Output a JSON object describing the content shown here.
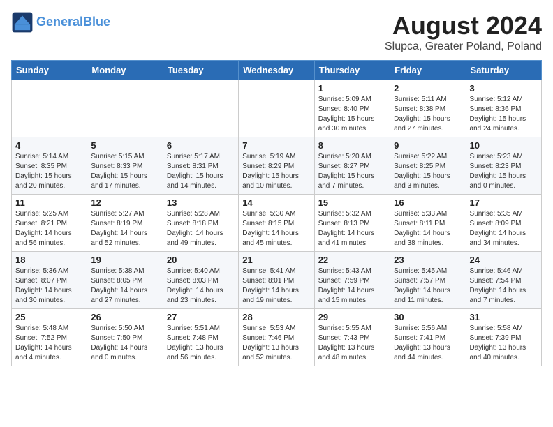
{
  "header": {
    "logo_line1": "General",
    "logo_line2": "Blue",
    "month_year": "August 2024",
    "location": "Slupca, Greater Poland, Poland"
  },
  "weekdays": [
    "Sunday",
    "Monday",
    "Tuesday",
    "Wednesday",
    "Thursday",
    "Friday",
    "Saturday"
  ],
  "weeks": [
    [
      {
        "day": "",
        "sunrise": "",
        "sunset": "",
        "daylight": ""
      },
      {
        "day": "",
        "sunrise": "",
        "sunset": "",
        "daylight": ""
      },
      {
        "day": "",
        "sunrise": "",
        "sunset": "",
        "daylight": ""
      },
      {
        "day": "",
        "sunrise": "",
        "sunset": "",
        "daylight": ""
      },
      {
        "day": "1",
        "sunrise": "Sunrise: 5:09 AM",
        "sunset": "Sunset: 8:40 PM",
        "daylight": "Daylight: 15 hours and 30 minutes."
      },
      {
        "day": "2",
        "sunrise": "Sunrise: 5:11 AM",
        "sunset": "Sunset: 8:38 PM",
        "daylight": "Daylight: 15 hours and 27 minutes."
      },
      {
        "day": "3",
        "sunrise": "Sunrise: 5:12 AM",
        "sunset": "Sunset: 8:36 PM",
        "daylight": "Daylight: 15 hours and 24 minutes."
      }
    ],
    [
      {
        "day": "4",
        "sunrise": "Sunrise: 5:14 AM",
        "sunset": "Sunset: 8:35 PM",
        "daylight": "Daylight: 15 hours and 20 minutes."
      },
      {
        "day": "5",
        "sunrise": "Sunrise: 5:15 AM",
        "sunset": "Sunset: 8:33 PM",
        "daylight": "Daylight: 15 hours and 17 minutes."
      },
      {
        "day": "6",
        "sunrise": "Sunrise: 5:17 AM",
        "sunset": "Sunset: 8:31 PM",
        "daylight": "Daylight: 15 hours and 14 minutes."
      },
      {
        "day": "7",
        "sunrise": "Sunrise: 5:19 AM",
        "sunset": "Sunset: 8:29 PM",
        "daylight": "Daylight: 15 hours and 10 minutes."
      },
      {
        "day": "8",
        "sunrise": "Sunrise: 5:20 AM",
        "sunset": "Sunset: 8:27 PM",
        "daylight": "Daylight: 15 hours and 7 minutes."
      },
      {
        "day": "9",
        "sunrise": "Sunrise: 5:22 AM",
        "sunset": "Sunset: 8:25 PM",
        "daylight": "Daylight: 15 hours and 3 minutes."
      },
      {
        "day": "10",
        "sunrise": "Sunrise: 5:23 AM",
        "sunset": "Sunset: 8:23 PM",
        "daylight": "Daylight: 15 hours and 0 minutes."
      }
    ],
    [
      {
        "day": "11",
        "sunrise": "Sunrise: 5:25 AM",
        "sunset": "Sunset: 8:21 PM",
        "daylight": "Daylight: 14 hours and 56 minutes."
      },
      {
        "day": "12",
        "sunrise": "Sunrise: 5:27 AM",
        "sunset": "Sunset: 8:19 PM",
        "daylight": "Daylight: 14 hours and 52 minutes."
      },
      {
        "day": "13",
        "sunrise": "Sunrise: 5:28 AM",
        "sunset": "Sunset: 8:18 PM",
        "daylight": "Daylight: 14 hours and 49 minutes."
      },
      {
        "day": "14",
        "sunrise": "Sunrise: 5:30 AM",
        "sunset": "Sunset: 8:15 PM",
        "daylight": "Daylight: 14 hours and 45 minutes."
      },
      {
        "day": "15",
        "sunrise": "Sunrise: 5:32 AM",
        "sunset": "Sunset: 8:13 PM",
        "daylight": "Daylight: 14 hours and 41 minutes."
      },
      {
        "day": "16",
        "sunrise": "Sunrise: 5:33 AM",
        "sunset": "Sunset: 8:11 PM",
        "daylight": "Daylight: 14 hours and 38 minutes."
      },
      {
        "day": "17",
        "sunrise": "Sunrise: 5:35 AM",
        "sunset": "Sunset: 8:09 PM",
        "daylight": "Daylight: 14 hours and 34 minutes."
      }
    ],
    [
      {
        "day": "18",
        "sunrise": "Sunrise: 5:36 AM",
        "sunset": "Sunset: 8:07 PM",
        "daylight": "Daylight: 14 hours and 30 minutes."
      },
      {
        "day": "19",
        "sunrise": "Sunrise: 5:38 AM",
        "sunset": "Sunset: 8:05 PM",
        "daylight": "Daylight: 14 hours and 27 minutes."
      },
      {
        "day": "20",
        "sunrise": "Sunrise: 5:40 AM",
        "sunset": "Sunset: 8:03 PM",
        "daylight": "Daylight: 14 hours and 23 minutes."
      },
      {
        "day": "21",
        "sunrise": "Sunrise: 5:41 AM",
        "sunset": "Sunset: 8:01 PM",
        "daylight": "Daylight: 14 hours and 19 minutes."
      },
      {
        "day": "22",
        "sunrise": "Sunrise: 5:43 AM",
        "sunset": "Sunset: 7:59 PM",
        "daylight": "Daylight: 14 hours and 15 minutes."
      },
      {
        "day": "23",
        "sunrise": "Sunrise: 5:45 AM",
        "sunset": "Sunset: 7:57 PM",
        "daylight": "Daylight: 14 hours and 11 minutes."
      },
      {
        "day": "24",
        "sunrise": "Sunrise: 5:46 AM",
        "sunset": "Sunset: 7:54 PM",
        "daylight": "Daylight: 14 hours and 7 minutes."
      }
    ],
    [
      {
        "day": "25",
        "sunrise": "Sunrise: 5:48 AM",
        "sunset": "Sunset: 7:52 PM",
        "daylight": "Daylight: 14 hours and 4 minutes."
      },
      {
        "day": "26",
        "sunrise": "Sunrise: 5:50 AM",
        "sunset": "Sunset: 7:50 PM",
        "daylight": "Daylight: 14 hours and 0 minutes."
      },
      {
        "day": "27",
        "sunrise": "Sunrise: 5:51 AM",
        "sunset": "Sunset: 7:48 PM",
        "daylight": "Daylight: 13 hours and 56 minutes."
      },
      {
        "day": "28",
        "sunrise": "Sunrise: 5:53 AM",
        "sunset": "Sunset: 7:46 PM",
        "daylight": "Daylight: 13 hours and 52 minutes."
      },
      {
        "day": "29",
        "sunrise": "Sunrise: 5:55 AM",
        "sunset": "Sunset: 7:43 PM",
        "daylight": "Daylight: 13 hours and 48 minutes."
      },
      {
        "day": "30",
        "sunrise": "Sunrise: 5:56 AM",
        "sunset": "Sunset: 7:41 PM",
        "daylight": "Daylight: 13 hours and 44 minutes."
      },
      {
        "day": "31",
        "sunrise": "Sunrise: 5:58 AM",
        "sunset": "Sunset: 7:39 PM",
        "daylight": "Daylight: 13 hours and 40 minutes."
      }
    ]
  ]
}
